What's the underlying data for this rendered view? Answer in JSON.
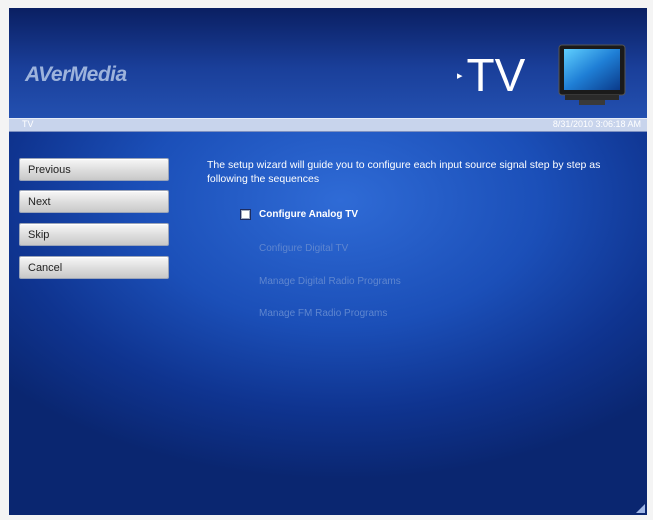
{
  "header": {
    "logo": "AVerMedia",
    "title_arrow": "▸",
    "title": "TV"
  },
  "status": {
    "left": "TV",
    "right": "8/31/2010 3:06:18 AM"
  },
  "nav": {
    "previous": "Previous",
    "next": "Next",
    "skip": "Skip",
    "cancel": "Cancel"
  },
  "wizard": {
    "intro": "The setup wizard will guide you to configure each input source signal step by step as following the sequences",
    "options": [
      {
        "label": "Configure Analog TV",
        "checked": false,
        "enabled": true
      },
      {
        "label": "Configure Digital TV",
        "enabled": false
      },
      {
        "label": "Manage Digital Radio Programs",
        "enabled": false
      },
      {
        "label": "Manage FM Radio Programs",
        "enabled": false
      }
    ]
  },
  "colors": {
    "background_center": "#2f6bd6",
    "background_edge": "#0a2670",
    "header_dark": "#0a1f62",
    "status_bar": "#c8d4ec",
    "disabled_text": "#5f86cf"
  }
}
